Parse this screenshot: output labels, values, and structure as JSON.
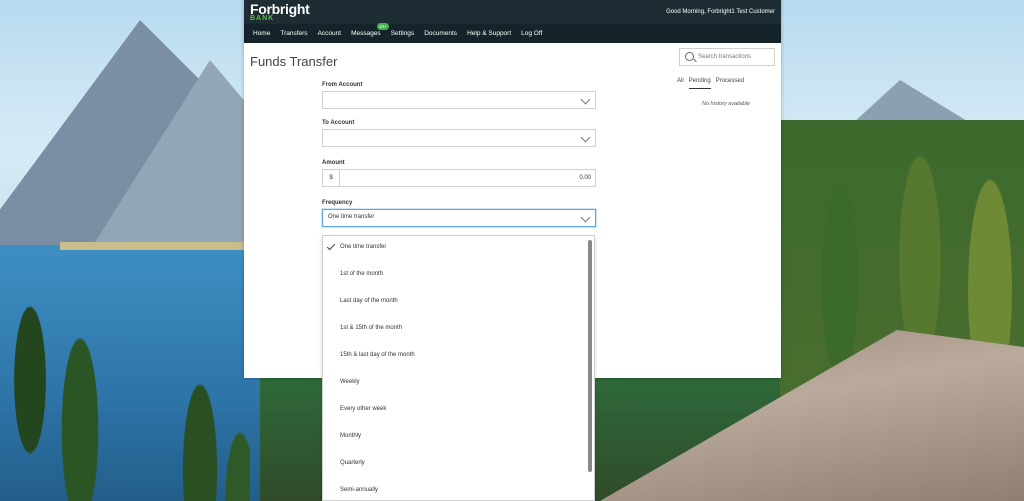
{
  "brand": {
    "name": "Forbright",
    "sub": "BANK"
  },
  "greeting": "Good Morning, Forbright1 Test Customer",
  "nav": [
    {
      "label": "Home"
    },
    {
      "label": "Transfers"
    },
    {
      "label": "Account"
    },
    {
      "label": "Messages",
      "badge": "10+"
    },
    {
      "label": "Settings"
    },
    {
      "label": "Documents"
    },
    {
      "label": "Help & Support"
    },
    {
      "label": "Log Off"
    }
  ],
  "page_title": "Funds Transfer",
  "form": {
    "from_label": "From Account",
    "to_label": "To Account",
    "amount_label": "Amount",
    "currency": "$",
    "amount_value": "0.00",
    "frequency_label": "Frequency",
    "frequency_value": "One time transfer"
  },
  "frequency_options": [
    {
      "label": "One time transfer",
      "selected": true
    },
    {
      "label": "1st of the month"
    },
    {
      "label": "Last day of the month"
    },
    {
      "label": "1st & 15th of the month"
    },
    {
      "label": "15th & last day of the month"
    },
    {
      "label": "Weekly"
    },
    {
      "label": "Every other week"
    },
    {
      "label": "Monthly"
    },
    {
      "label": "Quarterly"
    },
    {
      "label": "Semi-annually"
    }
  ],
  "search": {
    "placeholder": "Search transactions"
  },
  "tabs": [
    {
      "label": "All"
    },
    {
      "label": "Pending",
      "active": true
    },
    {
      "label": "Processed"
    }
  ],
  "history_empty": "No history available",
  "colors": {
    "topbar": "#1d2d33",
    "accent": "#3fb54a",
    "focus": "#5aa9e6"
  }
}
